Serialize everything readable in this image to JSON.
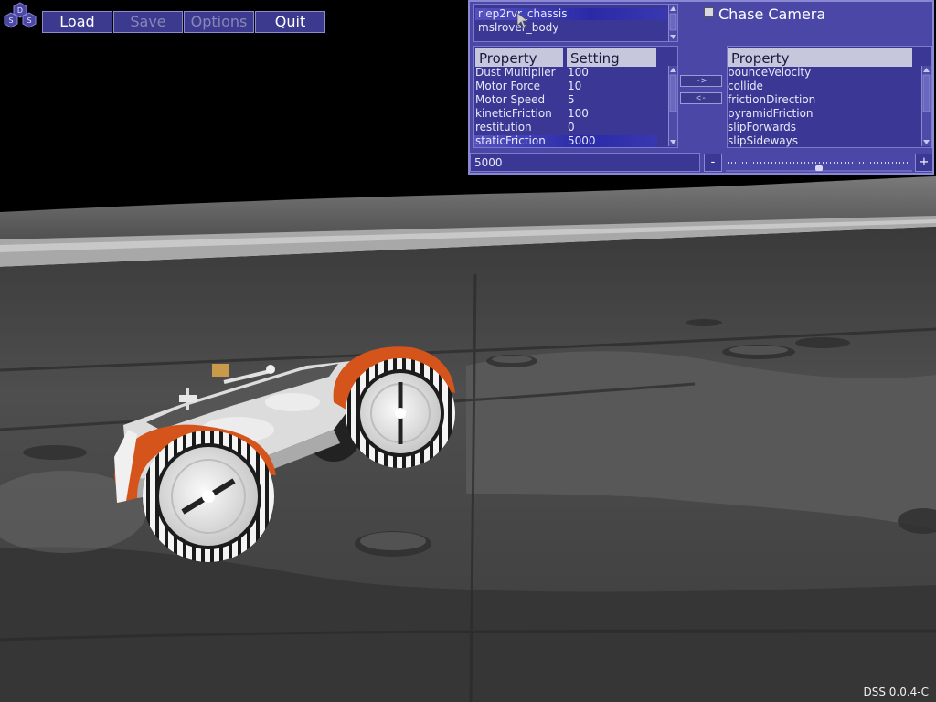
{
  "toolbar": {
    "load_label": "Load",
    "save_label": "Save",
    "options_label": "Options",
    "quit_label": "Quit",
    "logo_letters": [
      "D",
      "S",
      "S"
    ]
  },
  "panel": {
    "objects": [
      "rlep2rvr_chassis",
      "mslrover_body"
    ],
    "selected_object_index": 0,
    "chase_camera_label": "Chase Camera",
    "chase_camera_checked": false,
    "left_table": {
      "headers": [
        "Property",
        "Setting"
      ],
      "rows": [
        {
          "property": "Dust Multiplier",
          "setting": "100"
        },
        {
          "property": "Motor Force",
          "setting": "10"
        },
        {
          "property": "Motor Speed",
          "setting": "5"
        },
        {
          "property": "kineticFriction",
          "setting": "100"
        },
        {
          "property": "restitution",
          "setting": "0"
        },
        {
          "property": "staticFriction",
          "setting": "5000"
        }
      ],
      "selected_row_index": 5
    },
    "add_arrow_label": "->",
    "remove_arrow_label": "<-",
    "right_table": {
      "header": "Property",
      "rows": [
        "bounceVelocity",
        "collide",
        "frictionDirection",
        "pyramidFriction",
        "slipForwards",
        "slipSideways"
      ]
    },
    "value_field": "5000",
    "minus_label": "-",
    "plus_label": "+",
    "slider_fraction": 0.5
  },
  "footer": {
    "version": "DSS 0.0.4-C"
  },
  "colors": {
    "panel_bg": "#4a47a6",
    "rover_orange": "#d4541c",
    "terrain": "#4a4a4a"
  }
}
